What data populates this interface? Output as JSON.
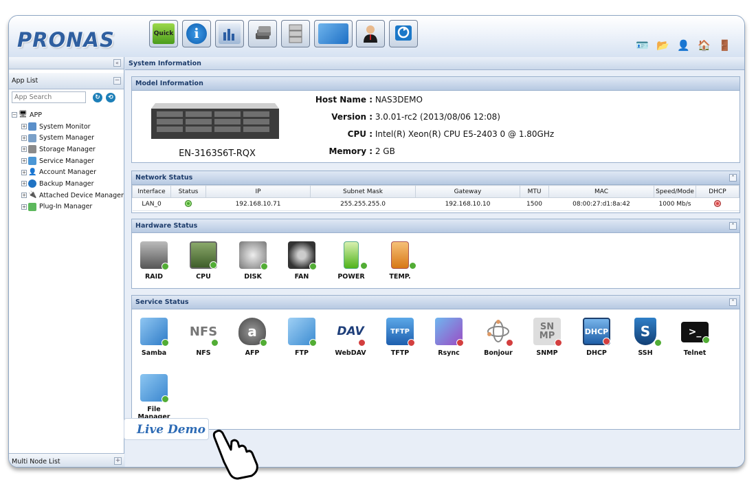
{
  "app": {
    "logo": "PRONAS"
  },
  "toolbar": {
    "buttons": [
      {
        "name": "quick",
        "label": "Quick"
      },
      {
        "name": "info",
        "label": "i"
      },
      {
        "name": "monitor",
        "label": ""
      },
      {
        "name": "storage",
        "label": ""
      },
      {
        "name": "server",
        "label": ""
      },
      {
        "name": "display",
        "label": ""
      },
      {
        "name": "account",
        "label": ""
      },
      {
        "name": "backup",
        "label": ""
      }
    ]
  },
  "left_panel": {
    "title": "App List",
    "search_placeholder": "App Search",
    "tree": {
      "root": "APP",
      "items": [
        "System Monitor",
        "System Manager",
        "Storage Manager",
        "Service Manager",
        "Account Manager",
        "Backup Manager",
        "Attached Device Manager",
        "Plug-In Manager"
      ]
    },
    "footer": "Multi Node List"
  },
  "main": {
    "title": "System Information",
    "model": {
      "title": "Model Information",
      "device_name": "EN-3163S6T-RQX",
      "host_name_label": "Host Name :",
      "host_name": "NAS3DEMO",
      "version_label": "Version :",
      "version": "3.0.01-rc2 (2013/08/06 12:08)",
      "cpu_label": "CPU :",
      "cpu": "Intel(R) Xeon(R) CPU E5-2403 0 @ 1.80GHz",
      "memory_label": "Memory :",
      "memory": "2 GB"
    },
    "network": {
      "title": "Network Status",
      "columns": [
        "Interface",
        "Status",
        "IP",
        "Subnet Mask",
        "Gateway",
        "MTU",
        "MAC",
        "Speed/Mode",
        "DHCP"
      ],
      "row": {
        "interface": "LAN_0",
        "ip": "192.168.10.71",
        "subnet": "255.255.255.0",
        "gateway": "192.168.10.10",
        "mtu": "1500",
        "mac": "08:00:27:d1:8a:42",
        "speed": "1000 Mb/s"
      }
    },
    "hardware": {
      "title": "Hardware Status",
      "items": [
        "RAID",
        "CPU",
        "DISK",
        "FAN",
        "POWER",
        "TEMP."
      ]
    },
    "services": {
      "title": "Service Status",
      "items": [
        "Samba",
        "NFS",
        "AFP",
        "FTP",
        "WebDAV",
        "TFTP",
        "Rsync",
        "Bonjour",
        "SNMP",
        "DHCP",
        "SSH",
        "Telnet"
      ],
      "item_file_manager_line1": "File",
      "item_file_manager_line2": "Manager"
    }
  },
  "live_demo": "Live Demo",
  "colors": {
    "accent": "#2f5fa0",
    "ok": "#4aa52e",
    "error": "#d64646"
  }
}
